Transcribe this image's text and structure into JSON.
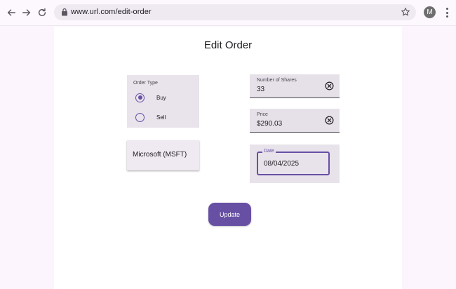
{
  "browser": {
    "url": "www.url.com/edit-order",
    "avatar_initial": "M",
    "icons": [
      "back-arrow-icon",
      "forward-arrow-icon",
      "reload-icon",
      "lock-icon",
      "star-icon",
      "more-vert-icon"
    ]
  },
  "page": {
    "title": "Edit Order"
  },
  "order_type": {
    "legend": "Order Type",
    "options": [
      {
        "label": "Buy",
        "selected": true
      },
      {
        "label": "Sell",
        "selected": false
      }
    ]
  },
  "stock": {
    "selected": "Microsoft (MSFT)"
  },
  "shares": {
    "label": "Number of Shares",
    "value": "33"
  },
  "price": {
    "label": "Price",
    "value": "$290.03"
  },
  "date": {
    "label": "Date",
    "value": "08/04/2025"
  },
  "actions": {
    "update_label": "Update"
  },
  "colors": {
    "primary": "#6750a4",
    "background": "#fcf5fd",
    "field_fill": "#e6e0e9"
  }
}
